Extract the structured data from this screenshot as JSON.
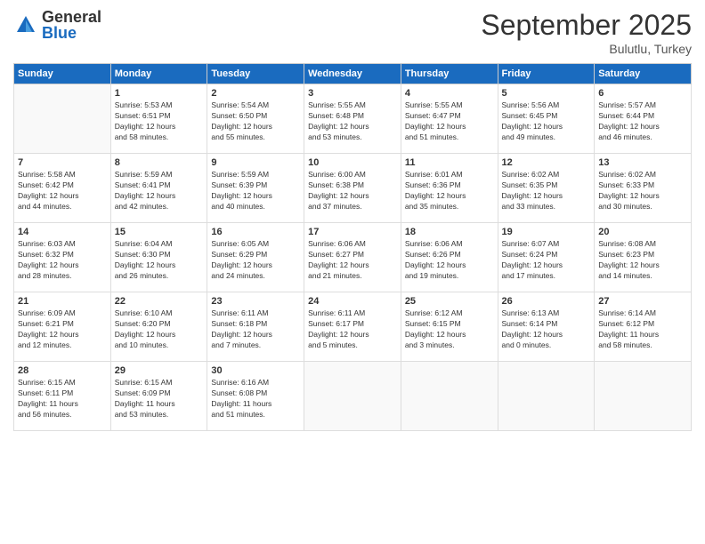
{
  "header": {
    "logo_general": "General",
    "logo_blue": "Blue",
    "month": "September 2025",
    "location": "Bulutlu, Turkey"
  },
  "days_of_week": [
    "Sunday",
    "Monday",
    "Tuesday",
    "Wednesday",
    "Thursday",
    "Friday",
    "Saturday"
  ],
  "weeks": [
    [
      {
        "day": "",
        "info": ""
      },
      {
        "day": "1",
        "info": "Sunrise: 5:53 AM\nSunset: 6:51 PM\nDaylight: 12 hours\nand 58 minutes."
      },
      {
        "day": "2",
        "info": "Sunrise: 5:54 AM\nSunset: 6:50 PM\nDaylight: 12 hours\nand 55 minutes."
      },
      {
        "day": "3",
        "info": "Sunrise: 5:55 AM\nSunset: 6:48 PM\nDaylight: 12 hours\nand 53 minutes."
      },
      {
        "day": "4",
        "info": "Sunrise: 5:55 AM\nSunset: 6:47 PM\nDaylight: 12 hours\nand 51 minutes."
      },
      {
        "day": "5",
        "info": "Sunrise: 5:56 AM\nSunset: 6:45 PM\nDaylight: 12 hours\nand 49 minutes."
      },
      {
        "day": "6",
        "info": "Sunrise: 5:57 AM\nSunset: 6:44 PM\nDaylight: 12 hours\nand 46 minutes."
      }
    ],
    [
      {
        "day": "7",
        "info": "Sunrise: 5:58 AM\nSunset: 6:42 PM\nDaylight: 12 hours\nand 44 minutes."
      },
      {
        "day": "8",
        "info": "Sunrise: 5:59 AM\nSunset: 6:41 PM\nDaylight: 12 hours\nand 42 minutes."
      },
      {
        "day": "9",
        "info": "Sunrise: 5:59 AM\nSunset: 6:39 PM\nDaylight: 12 hours\nand 40 minutes."
      },
      {
        "day": "10",
        "info": "Sunrise: 6:00 AM\nSunset: 6:38 PM\nDaylight: 12 hours\nand 37 minutes."
      },
      {
        "day": "11",
        "info": "Sunrise: 6:01 AM\nSunset: 6:36 PM\nDaylight: 12 hours\nand 35 minutes."
      },
      {
        "day": "12",
        "info": "Sunrise: 6:02 AM\nSunset: 6:35 PM\nDaylight: 12 hours\nand 33 minutes."
      },
      {
        "day": "13",
        "info": "Sunrise: 6:02 AM\nSunset: 6:33 PM\nDaylight: 12 hours\nand 30 minutes."
      }
    ],
    [
      {
        "day": "14",
        "info": "Sunrise: 6:03 AM\nSunset: 6:32 PM\nDaylight: 12 hours\nand 28 minutes."
      },
      {
        "day": "15",
        "info": "Sunrise: 6:04 AM\nSunset: 6:30 PM\nDaylight: 12 hours\nand 26 minutes."
      },
      {
        "day": "16",
        "info": "Sunrise: 6:05 AM\nSunset: 6:29 PM\nDaylight: 12 hours\nand 24 minutes."
      },
      {
        "day": "17",
        "info": "Sunrise: 6:06 AM\nSunset: 6:27 PM\nDaylight: 12 hours\nand 21 minutes."
      },
      {
        "day": "18",
        "info": "Sunrise: 6:06 AM\nSunset: 6:26 PM\nDaylight: 12 hours\nand 19 minutes."
      },
      {
        "day": "19",
        "info": "Sunrise: 6:07 AM\nSunset: 6:24 PM\nDaylight: 12 hours\nand 17 minutes."
      },
      {
        "day": "20",
        "info": "Sunrise: 6:08 AM\nSunset: 6:23 PM\nDaylight: 12 hours\nand 14 minutes."
      }
    ],
    [
      {
        "day": "21",
        "info": "Sunrise: 6:09 AM\nSunset: 6:21 PM\nDaylight: 12 hours\nand 12 minutes."
      },
      {
        "day": "22",
        "info": "Sunrise: 6:10 AM\nSunset: 6:20 PM\nDaylight: 12 hours\nand 10 minutes."
      },
      {
        "day": "23",
        "info": "Sunrise: 6:11 AM\nSunset: 6:18 PM\nDaylight: 12 hours\nand 7 minutes."
      },
      {
        "day": "24",
        "info": "Sunrise: 6:11 AM\nSunset: 6:17 PM\nDaylight: 12 hours\nand 5 minutes."
      },
      {
        "day": "25",
        "info": "Sunrise: 6:12 AM\nSunset: 6:15 PM\nDaylight: 12 hours\nand 3 minutes."
      },
      {
        "day": "26",
        "info": "Sunrise: 6:13 AM\nSunset: 6:14 PM\nDaylight: 12 hours\nand 0 minutes."
      },
      {
        "day": "27",
        "info": "Sunrise: 6:14 AM\nSunset: 6:12 PM\nDaylight: 11 hours\nand 58 minutes."
      }
    ],
    [
      {
        "day": "28",
        "info": "Sunrise: 6:15 AM\nSunset: 6:11 PM\nDaylight: 11 hours\nand 56 minutes."
      },
      {
        "day": "29",
        "info": "Sunrise: 6:15 AM\nSunset: 6:09 PM\nDaylight: 11 hours\nand 53 minutes."
      },
      {
        "day": "30",
        "info": "Sunrise: 6:16 AM\nSunset: 6:08 PM\nDaylight: 11 hours\nand 51 minutes."
      },
      {
        "day": "",
        "info": ""
      },
      {
        "day": "",
        "info": ""
      },
      {
        "day": "",
        "info": ""
      },
      {
        "day": "",
        "info": ""
      }
    ]
  ]
}
